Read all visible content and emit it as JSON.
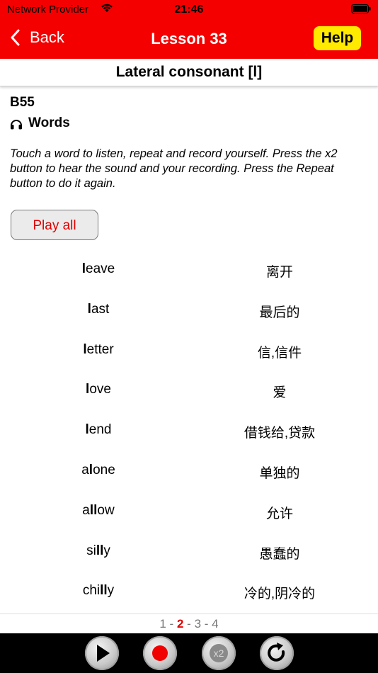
{
  "status": {
    "carrier": "Network Provider",
    "time": "21:46"
  },
  "nav": {
    "back_label": "Back",
    "title": "Lesson 33",
    "help_label": "Help"
  },
  "subtitle": "Lateral consonant [l]",
  "section_code": "B55",
  "section_heading": "Words",
  "instructions": "Touch a word to listen, repeat and record yourself. Press the x2 button to hear the sound and your recording. Press the Repeat button to do it again.",
  "play_all_label": "Play all",
  "words": [
    {
      "pre": "",
      "bold": "l",
      "post": "eave",
      "zh": "离开"
    },
    {
      "pre": "",
      "bold": "l",
      "post": "ast",
      "zh": "最后的"
    },
    {
      "pre": "",
      "bold": "l",
      "post": "etter",
      "zh": "信,信件"
    },
    {
      "pre": "",
      "bold": "l",
      "post": "ove",
      "zh": "爱"
    },
    {
      "pre": "",
      "bold": "l",
      "post": "end",
      "zh": "借钱给,贷款"
    },
    {
      "pre": "a",
      "bold": "l",
      "post": "one",
      "zh": "单独的"
    },
    {
      "pre": "a",
      "bold": "ll",
      "post": "ow",
      "zh": "允许"
    },
    {
      "pre": "si",
      "bold": "ll",
      "post": "y",
      "zh": "愚蠢的"
    },
    {
      "pre": "chi",
      "bold": "ll",
      "post": "y",
      "zh": "冷的,阴冷的"
    }
  ],
  "pager": {
    "pages": [
      "1",
      "2",
      "3",
      "4"
    ],
    "separator": "-",
    "current": "2"
  },
  "toolbar": {
    "play_icon": "play-icon",
    "record_icon": "record-icon",
    "x2_label": "x2",
    "repeat_icon": "repeat-icon"
  },
  "colors": {
    "header": "#f40000",
    "help": "#ffea00",
    "accent_text": "#e00000"
  }
}
